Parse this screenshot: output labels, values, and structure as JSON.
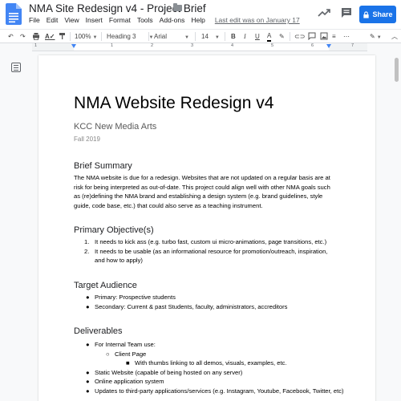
{
  "header": {
    "doc_title": "NMA Site Redesign v4 - Project Brief",
    "menu": [
      "File",
      "Edit",
      "View",
      "Insert",
      "Format",
      "Tools",
      "Add-ons",
      "Help"
    ],
    "last_edit": "Last edit was on January 17",
    "share_label": "Share"
  },
  "toolbar": {
    "zoom": "100%",
    "style": "Heading 3",
    "font": "Arial",
    "font_size": "14"
  },
  "ruler": {
    "numbers": [
      "1",
      "1",
      "2",
      "3",
      "4",
      "5",
      "6",
      "7"
    ]
  },
  "colors": {
    "accent": "#1a73e8",
    "docs_blue": "#4285f4"
  },
  "document": {
    "title": "NMA Website Redesign v4",
    "subtitle": "KCC New Media Arts",
    "date": "Fall 2019",
    "brief_heading": "Brief Summary",
    "brief_lines": [
      "The NMA website is due for a redesign. Websites that are not updated on a regular basis are at",
      "risk for being interpreted as out-of-date. This project could align well with other NMA goals such",
      "as (re)defining the NMA brand and establishing a design system (e.g. brand guidelines, style",
      "guide, code base, etc.) that could also serve as a teaching instrument."
    ],
    "objectives_heading": "Primary Objective(s)",
    "objectives": [
      {
        "num": "1.",
        "lines": [
          "It needs to kick ass (e.g. turbo fast, custom ui micro-animations, page transitions, etc.)"
        ]
      },
      {
        "num": "2.",
        "lines": [
          "It needs to be usable (as an informational resource for promotion/outreach, inspiration,",
          "and how to apply)"
        ]
      }
    ],
    "audience_heading": "Target Audience",
    "audience": [
      "Primary: Prospective students",
      "Secondary: Current & past Students, faculty, administrators, accreditors"
    ],
    "deliverables_heading": "Deliverables",
    "deliverables": {
      "internal": "For Internal Team use:",
      "client_page": "Client Page",
      "thumbs": "With thumbs linking to all demos, visuals, examples, etc.",
      "static": "Static Website (capable of being hosted on any server)",
      "online_app": "Online application system",
      "updates": "Updates to third-party applications/services (e.g. Instagram, Youtube, Facebook, Twitter, etc)"
    }
  }
}
